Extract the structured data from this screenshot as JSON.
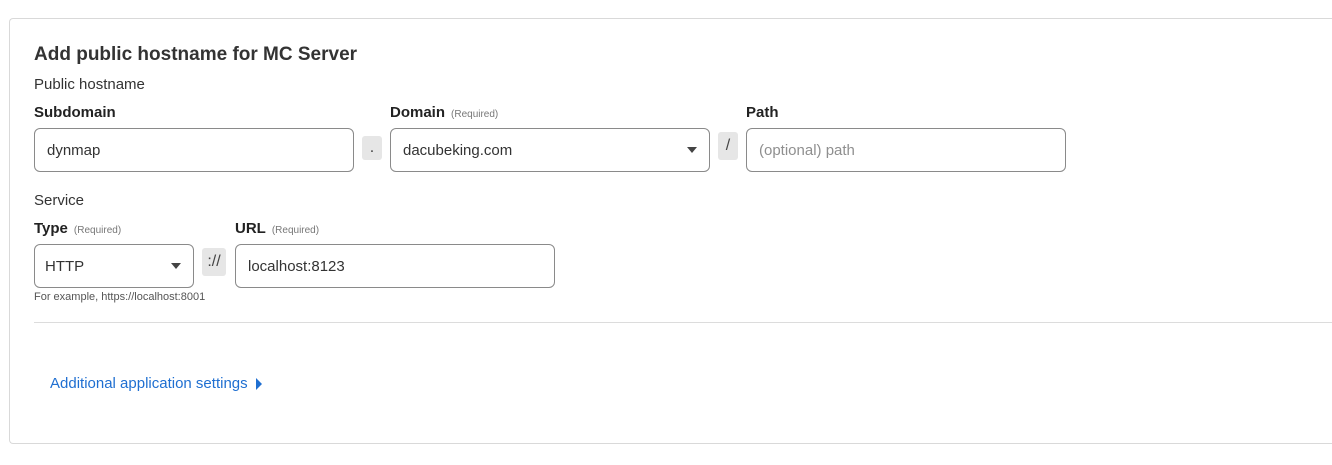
{
  "form": {
    "title": "Add public hostname for MC Server",
    "public_hostname_label": "Public hostname",
    "subdomain": {
      "label": "Subdomain",
      "value": "dynmap"
    },
    "dot_separator": ".",
    "domain": {
      "label": "Domain",
      "required": "(Required)",
      "value": "dacubeking.com"
    },
    "slash_separator": "/",
    "path": {
      "label": "Path",
      "placeholder": "(optional) path",
      "value": ""
    },
    "service_label": "Service",
    "type": {
      "label": "Type",
      "required": "(Required)",
      "value": "HTTP",
      "helper": "For example, https://localhost:8001"
    },
    "scheme_separator": "://",
    "url": {
      "label": "URL",
      "required": "(Required)",
      "value": "localhost:8123"
    },
    "additional_settings_link": "Additional application settings"
  },
  "icons": {
    "domain_dropdown": "caret-down-icon",
    "type_dropdown": "caret-down-icon",
    "link_arrow": "caret-right-icon"
  },
  "colors": {
    "link": "#1f6fd1",
    "separator_bg": "#e6e6e6",
    "border": "#8a8a8a"
  }
}
